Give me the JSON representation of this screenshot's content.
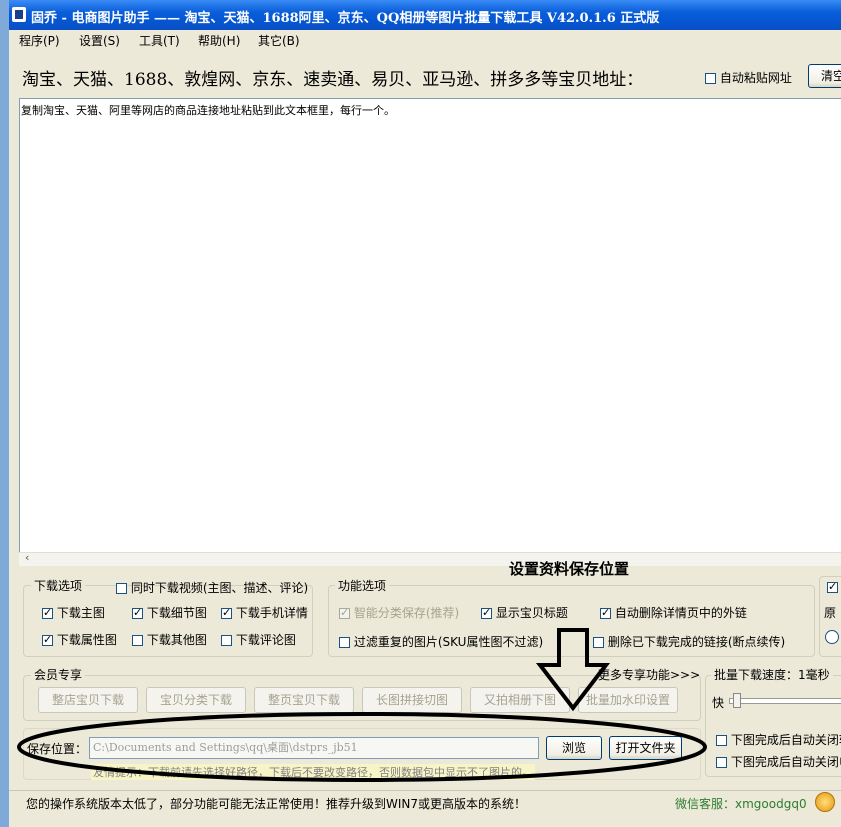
{
  "window": {
    "title": "固乔 - 电商图片助手 —— 淘宝、天猫、1688阿里、京东、QQ相册等图片批量下载工具 V42.0.1.6 正式版"
  },
  "menu": [
    "程序(P)",
    "设置(S)",
    "工具(T)",
    "帮助(H)",
    "其它(B)"
  ],
  "url_bar": {
    "label": "淘宝、天猫、1688、敦煌网、京东、速卖通、易贝、亚马逊、拼多多等宝贝地址：",
    "auto_paste": "自动粘贴网址",
    "auto_paste_checked": false,
    "clear": "清空"
  },
  "textarea": {
    "placeholder": "复制淘宝、天猫、阿里等网店的商品连接地址粘贴到此文本框里，每行一个。"
  },
  "annotation": {
    "text": "设置资料保存位置"
  },
  "download_options": {
    "label": "下载选项",
    "video": {
      "label": "同时下载视频(主图、描述、评论)",
      "checked": false
    },
    "items": [
      {
        "label": "下载主图",
        "checked": true
      },
      {
        "label": "下载细节图",
        "checked": true
      },
      {
        "label": "下载手机详情",
        "checked": true
      },
      {
        "label": "下载属性图",
        "checked": true
      },
      {
        "label": "下载其他图",
        "checked": false
      },
      {
        "label": "下载评论图",
        "checked": false
      }
    ]
  },
  "function_options": {
    "label": "功能选项",
    "items": [
      {
        "label": "智能分类保存(推荐)",
        "checked": true,
        "disabled": true
      },
      {
        "label": "显示宝贝标题",
        "checked": true,
        "disabled": false
      },
      {
        "label": "自动删除详情页中的外链",
        "checked": true,
        "disabled": false
      },
      {
        "label": "过滤重复的图片(SKU属性图不过滤)",
        "checked": false,
        "disabled": false
      },
      {
        "label": "删除已下载完成的链接(断点续传)",
        "checked": false,
        "disabled": false
      }
    ]
  },
  "right_options": {
    "label": "原"
  },
  "member": {
    "label": "会员专享",
    "more": "更多专享功能>>>",
    "buttons": [
      "整店宝贝下载",
      "宝贝分类下载",
      "整页宝贝下载",
      "长图拼接切图",
      "又拍相册下图",
      "批量加水印设置"
    ]
  },
  "speed": {
    "label": "批量下载速度：1毫秒",
    "fast": "快",
    "close_when_done": "下图完成后自动关闭软",
    "close_when_done_2": "下图完成后自动关闭电"
  },
  "save": {
    "label": "保存位置：",
    "path": "C:\\Documents and Settings\\qq\\桌面\\dstprs_jb51",
    "browse": "浏览",
    "open_folder": "打开文件夹",
    "tip": "友情提示：下载前请先选择好路径，下载后不要改变路径，否则数据包中显示不了图片的。"
  },
  "status": {
    "message": "您的操作系统版本太低了，部分功能可能无法正常使用！推荐升级到WIN7或更高版本的系统！",
    "service": "微信客服：xmgoodgq0"
  },
  "colors": {
    "titlebar": "#0556d2",
    "face": "#ece9d8",
    "service_text": "#2e7d32",
    "annotation": "#000000"
  }
}
